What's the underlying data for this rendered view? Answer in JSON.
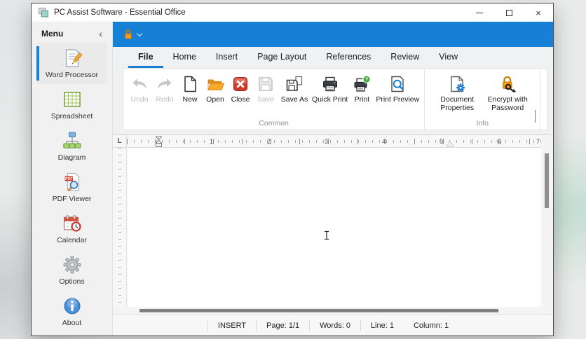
{
  "window": {
    "title": "PC Assist Software - Essential Office"
  },
  "icons": {
    "close_glyph": "×",
    "sidebar_collapse_glyph": "‹"
  },
  "sidebar": {
    "header": "Menu",
    "items": [
      {
        "label": "Word Processor",
        "icon": "word-processor-icon",
        "selected": true
      },
      {
        "label": "Spreadsheet",
        "icon": "spreadsheet-icon",
        "selected": false
      },
      {
        "label": "Diagram",
        "icon": "diagram-icon",
        "selected": false
      },
      {
        "label": "PDF Viewer",
        "icon": "pdf-viewer-icon",
        "selected": false
      },
      {
        "label": "Calendar",
        "icon": "calendar-icon",
        "selected": false
      },
      {
        "label": "Options",
        "icon": "options-icon",
        "selected": false
      },
      {
        "label": "About",
        "icon": "about-icon",
        "selected": false
      }
    ]
  },
  "ribbon": {
    "accent_color": "#1580d5",
    "tabs": [
      {
        "label": "File",
        "selected": true
      },
      {
        "label": "Home",
        "selected": false
      },
      {
        "label": "Insert",
        "selected": false
      },
      {
        "label": "Page Layout",
        "selected": false
      },
      {
        "label": "References",
        "selected": false
      },
      {
        "label": "Review",
        "selected": false
      },
      {
        "label": "View",
        "selected": false
      }
    ],
    "groups": [
      {
        "label": "Common",
        "buttons": [
          {
            "label": "Undo",
            "icon": "undo-icon",
            "disabled": true
          },
          {
            "label": "Redo",
            "icon": "redo-icon",
            "disabled": true
          },
          {
            "label": "New",
            "icon": "new-document-icon",
            "disabled": false
          },
          {
            "label": "Open",
            "icon": "open-folder-icon",
            "disabled": false
          },
          {
            "label": "Close",
            "icon": "close-document-icon",
            "disabled": false
          },
          {
            "label": "Save",
            "icon": "save-icon",
            "disabled": true
          },
          {
            "label": "Save As",
            "icon": "save-as-icon",
            "disabled": false
          },
          {
            "label": "Quick Print",
            "icon": "quick-print-icon",
            "disabled": false
          },
          {
            "label": "Print",
            "icon": "print-icon",
            "disabled": false
          },
          {
            "label": "Print Preview",
            "icon": "print-preview-icon",
            "disabled": false
          }
        ]
      },
      {
        "label": "Info",
        "buttons": [
          {
            "label": "Document Properties",
            "icon": "document-properties-icon",
            "disabled": false
          },
          {
            "label": "Encrypt with Password",
            "icon": "encrypt-password-icon",
            "disabled": false
          }
        ]
      }
    ]
  },
  "ruler": {
    "tab_selector": "L",
    "numbers": [
      "1",
      "2",
      "3",
      "4",
      "5",
      "6",
      "7"
    ]
  },
  "statusbar": {
    "insert_mode": "INSERT",
    "page": "Page: 1/1",
    "words": "Words: 0",
    "line": "Line: 1",
    "column": "Column: 1"
  }
}
